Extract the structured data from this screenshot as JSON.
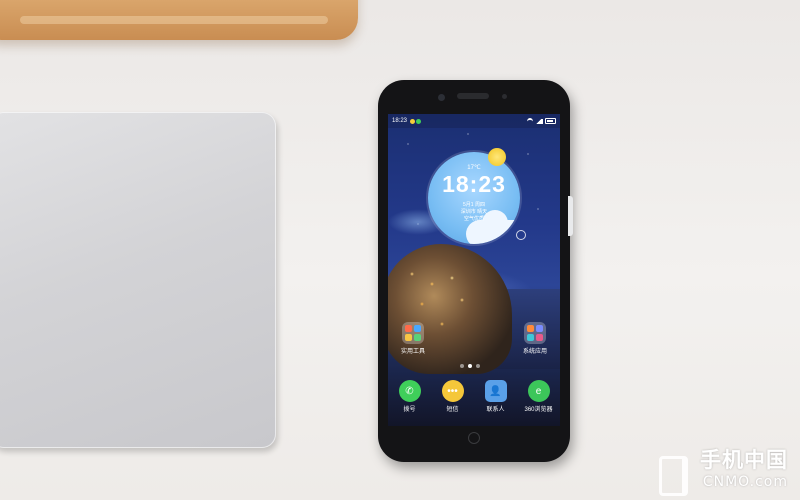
{
  "status_bar": {
    "time": "18:23"
  },
  "clock_widget": {
    "temperature": "17℃",
    "time": "18:23",
    "date": "5月1 周四",
    "weather": "深圳市 晴天",
    "air_quality": "空气优质"
  },
  "folders": [
    {
      "label": "实用工具"
    },
    {
      "label": "系统应用"
    }
  ],
  "dock": [
    {
      "label": "拨号",
      "icon": "phone-icon",
      "color": "#3fcf5a"
    },
    {
      "label": "短信",
      "icon": "message-icon",
      "color": "#f5c73a"
    },
    {
      "label": "联系人",
      "icon": "contacts-icon",
      "color": "#5aa0e8"
    },
    {
      "label": "360浏览器",
      "icon": "browser-icon",
      "color": "#3cc65a"
    }
  ],
  "watermark": {
    "cn": "手机中国",
    "en": "CNMO.com"
  },
  "colors": {
    "sun": "#f6cf3a",
    "widget": "#78bdf3",
    "phone_body": "#141416"
  }
}
